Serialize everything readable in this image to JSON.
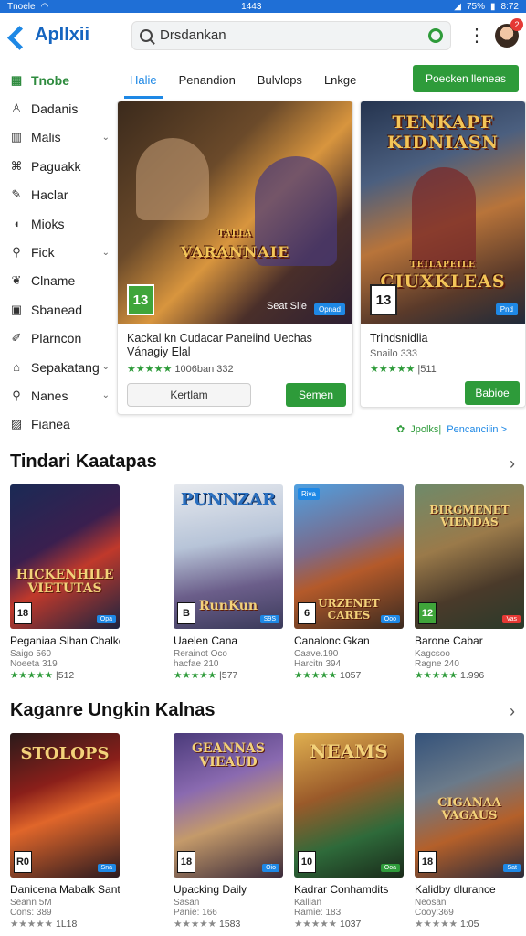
{
  "status": {
    "left": "Tnoele",
    "time": "1443",
    "battery": "75%",
    "clock": "8:72"
  },
  "app": {
    "name": "Apllxii"
  },
  "search": {
    "value": "Drsdankan",
    "placeholder": "Search"
  },
  "notifications": {
    "count": "2"
  },
  "sidebar": {
    "items": [
      {
        "label": "Tnobe",
        "icon": "chart-icon",
        "active": true
      },
      {
        "label": "Dadanis",
        "icon": "person-icon"
      },
      {
        "label": "Malis",
        "icon": "bars-icon",
        "chevron": true
      },
      {
        "label": "Paguakk",
        "icon": "gamepad-icon"
      },
      {
        "label": "Haclar",
        "icon": "edit-icon"
      },
      {
        "label": "Mioks",
        "icon": "speaker-icon"
      },
      {
        "label": "Fick",
        "icon": "search-icon",
        "chevron": true
      },
      {
        "label": "Clname",
        "icon": "leaf-icon"
      },
      {
        "label": "Sbanead",
        "icon": "box-icon"
      },
      {
        "label": "Plarncon",
        "icon": "pen-icon"
      },
      {
        "label": "Sepakatang",
        "icon": "tag-icon",
        "chevron": true
      },
      {
        "label": "Nanes",
        "icon": "search-icon",
        "chevron": true
      },
      {
        "label": "Fianea",
        "icon": "image-icon"
      }
    ]
  },
  "tabs": [
    {
      "label": "Halie",
      "active": true
    },
    {
      "label": "Penandion"
    },
    {
      "label": "Bulvlops"
    },
    {
      "label": "Lnkge"
    }
  ],
  "tabs_cta": "Poecken lleneas",
  "featured": [
    {
      "art_title": "VARANNAIE",
      "art_sub": "TALLA",
      "art_brand": "Seat Sile",
      "art_tag": "Opnad",
      "rating": "13",
      "title": "Kackal kn Cudacar Paneiind Uechas Vánagiy Elal",
      "stars": "★★★★★",
      "count": "1006ban 332",
      "ghost": "Kertlam",
      "button": "Semen"
    },
    {
      "art_title": "TENKAPF KIDNIASN",
      "art_title2": "CIUXKLEAS",
      "art_sub": "TEILAPEILE",
      "art_tag": "Pnd",
      "rating": "13",
      "title": "Trindsnidlia",
      "sub": "Snailo 333",
      "stars": "★★★★★",
      "count": "|511",
      "button": "Babioe"
    }
  ],
  "links": {
    "a": "Jpolks|",
    "b": "Pencancilin >"
  },
  "sections": [
    {
      "title": "Tindari Kaatapas",
      "items": [
        {
          "art": "HICKENHILE VIETUTAS",
          "rating": "18",
          "tag": "Opa",
          "name": "Peganiaa Slhan Chalken",
          "sub": "Saigo 560",
          "sub2": "Noeeta 319",
          "stars": "★★★★★",
          "count": "|512"
        },
        {
          "art": "PUNNZAR",
          "art2": "RunKun",
          "rating": "B",
          "tag": "S9S",
          "name": "Uaelen Cana",
          "sub": "Rerainot Oco",
          "sub2": "hacfae 210",
          "stars": "★★★★★",
          "count": "|577"
        },
        {
          "art": "URZENET CARES",
          "rating": "6",
          "tag": "Ooo",
          "badge": "Riva",
          "name": "Canalonc Gkan",
          "sub": "Caave.190",
          "sub2": "Harcitn 394",
          "stars": "★★★★★",
          "count": "1057"
        },
        {
          "art": "BIRGMENET VIENDAS",
          "rating": "12",
          "tag": "Vas",
          "name": "Barone Cabar",
          "sub": "Kagcsoo",
          "sub2": "Ragne 240",
          "stars": "★★★★★",
          "count": "1.996"
        }
      ]
    },
    {
      "title": "Kaganre Ungkin Kalnas",
      "items": [
        {
          "art": "STOLOPS",
          "rating": "R0",
          "tag": "Sna",
          "name": "Danicena Mabalk Santegits",
          "sub": "Seann 5M",
          "sub2": "Cons: 389",
          "stars": "★★★★★",
          "count": "1L18",
          "grey": true
        },
        {
          "art": "GEANNAS VIEAUD",
          "rating": "18",
          "tag": "Oio",
          "name": "Upacking Daily",
          "sub": "Sasan",
          "sub2": "Panie: 166",
          "stars": "★★★★★",
          "count": "1583",
          "grey": true
        },
        {
          "art": "NEAMS",
          "rating": "10",
          "tag": "Ooa",
          "name": "Kadrar Conhamdits",
          "sub": "Kallian",
          "sub2": "Ramie: 183",
          "stars": "★★★★★",
          "count": "1037",
          "grey": true
        },
        {
          "art": "CIGANAA VAGAUS",
          "rating": "18",
          "tag": "Sat",
          "name": "Kalidby dlurance",
          "sub": "Neosan",
          "sub2": "Cooy:369",
          "stars": "★★★★★",
          "count": "1:05",
          "grey": true
        }
      ]
    }
  ],
  "colors": {
    "accent_green": "#2e9b3a",
    "accent_blue": "#1e88e5",
    "status_bar": "#1f6fd6"
  }
}
